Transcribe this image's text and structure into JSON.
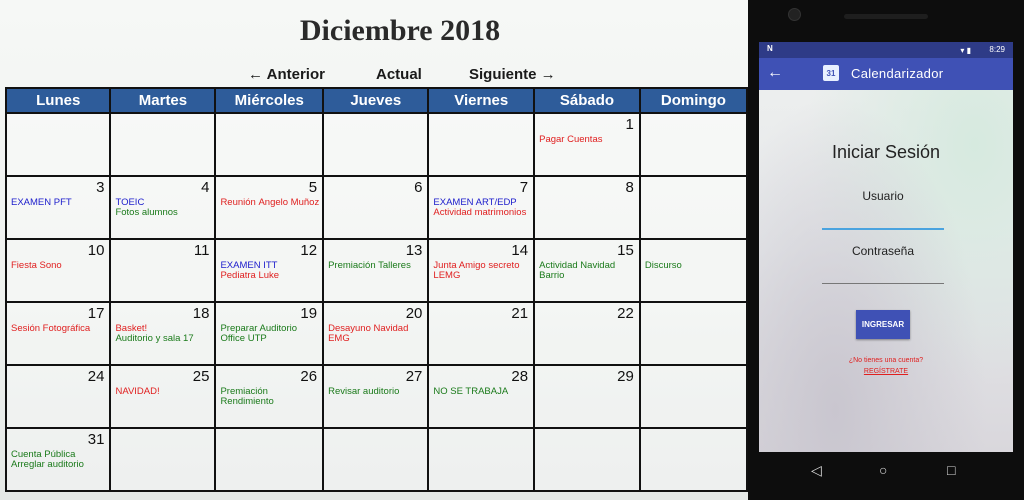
{
  "calendar": {
    "title": "Diciembre 2018",
    "nav": {
      "prev": "← Anterior",
      "current": "Actual",
      "next": "Siguiente →"
    },
    "weekdays": [
      "Lunes",
      "Martes",
      "Miércoles",
      "Jueves",
      "Viernes",
      "Sábado",
      "Domingo"
    ],
    "weeks": [
      [
        {
          "day": "",
          "events": []
        },
        {
          "day": "",
          "events": []
        },
        {
          "day": "",
          "events": []
        },
        {
          "day": "",
          "events": []
        },
        {
          "day": "",
          "events": []
        },
        {
          "day": "1",
          "events": [
            {
              "text": "Pagar Cuentas",
              "color": "red"
            }
          ]
        },
        {
          "day": "",
          "events": []
        }
      ],
      [
        {
          "day": "3",
          "events": [
            {
              "text": "EXAMEN PFT",
              "color": "blue"
            }
          ]
        },
        {
          "day": "4",
          "events": [
            {
              "text": "TOEIC",
              "color": "blue"
            },
            {
              "text": "Fotos alumnos",
              "color": "green"
            }
          ]
        },
        {
          "day": "5",
          "events": [
            {
              "text": "Reunión Ángelo Muñoz",
              "color": "red"
            }
          ]
        },
        {
          "day": "6",
          "events": []
        },
        {
          "day": "7",
          "events": [
            {
              "text": "EXAMEN ART/EDP",
              "color": "blue"
            },
            {
              "text": "Actividad matrimonios",
              "color": "red"
            }
          ]
        },
        {
          "day": "8",
          "events": []
        },
        {
          "day": "",
          "events": []
        }
      ],
      [
        {
          "day": "10",
          "events": [
            {
              "text": "Fiesta Sono",
              "color": "red"
            }
          ]
        },
        {
          "day": "11",
          "events": []
        },
        {
          "day": "12",
          "events": [
            {
              "text": "EXAMEN ITT",
              "color": "blue"
            },
            {
              "text": "Pediatra Luke",
              "color": "red"
            }
          ]
        },
        {
          "day": "13",
          "events": [
            {
              "text": "Premiación Talleres",
              "color": "green"
            }
          ]
        },
        {
          "day": "14",
          "events": [
            {
              "text": "Junta Amigo secreto",
              "color": "red"
            },
            {
              "text": "LEMG",
              "color": "red"
            }
          ]
        },
        {
          "day": "15",
          "events": [
            {
              "text": "Actividad Navidad",
              "color": "green"
            },
            {
              "text": "Barrio",
              "color": "green"
            }
          ]
        },
        {
          "day": "",
          "events": [
            {
              "text": "Discurso",
              "color": "green"
            }
          ]
        }
      ],
      [
        {
          "day": "17",
          "events": [
            {
              "text": "Sesión Fotográfica",
              "color": "red"
            }
          ]
        },
        {
          "day": "18",
          "events": [
            {
              "text": "Basket!",
              "color": "red"
            },
            {
              "text": "Auditorio y sala 17",
              "color": "green"
            }
          ]
        },
        {
          "day": "19",
          "events": [
            {
              "text": "Preparar Auditorio",
              "color": "green"
            },
            {
              "text": "Office UTP",
              "color": "green"
            }
          ]
        },
        {
          "day": "20",
          "events": [
            {
              "text": "Desayuno Navidad",
              "color": "red"
            },
            {
              "text": "EMG",
              "color": "red"
            }
          ]
        },
        {
          "day": "21",
          "events": []
        },
        {
          "day": "22",
          "events": []
        },
        {
          "day": "",
          "events": []
        }
      ],
      [
        {
          "day": "24",
          "events": []
        },
        {
          "day": "25",
          "events": [
            {
              "text": "NAVIDAD!",
              "color": "red"
            }
          ]
        },
        {
          "day": "26",
          "events": [
            {
              "text": "Premiación",
              "color": "green"
            },
            {
              "text": "Rendimiento",
              "color": "green"
            }
          ]
        },
        {
          "day": "27",
          "events": [
            {
              "text": "Revisar auditorio",
              "color": "green"
            }
          ]
        },
        {
          "day": "28",
          "events": [
            {
              "text": "NO SE TRABAJA",
              "color": "green"
            }
          ]
        },
        {
          "day": "29",
          "events": []
        },
        {
          "day": "",
          "events": []
        }
      ],
      [
        {
          "day": "31",
          "events": [
            {
              "text": "Cuenta Pública",
              "color": "green"
            },
            {
              "text": "Arreglar auditorio",
              "color": "green"
            }
          ]
        },
        {
          "day": "",
          "events": []
        },
        {
          "day": "",
          "events": []
        },
        {
          "day": "",
          "events": []
        },
        {
          "day": "",
          "events": []
        },
        {
          "day": "",
          "events": []
        },
        {
          "day": "",
          "events": []
        }
      ]
    ]
  },
  "phone": {
    "status": {
      "notification": "N",
      "icons": "▾ ▮",
      "time": "8:29"
    },
    "appbar": {
      "back_icon": "arrow-back-icon",
      "calendar_icon_text": "31",
      "title": "Calendarizador"
    },
    "login": {
      "title": "Iniciar Sesión",
      "user_label": "Usuario",
      "password_label": "Contraseña",
      "submit": "INGRESAR",
      "question": "¿No tienes una cuenta?",
      "register": "REGÍSTRATE"
    },
    "navbar": {
      "back": "◁",
      "home": "○",
      "recents": "□"
    }
  },
  "colors": {
    "header": "#2e5c9a",
    "blue": "#1c1ccc",
    "red": "#e02020",
    "green": "#1a7a1a",
    "appbar": "#3f51b5",
    "accent_line": "#4aa3df"
  }
}
